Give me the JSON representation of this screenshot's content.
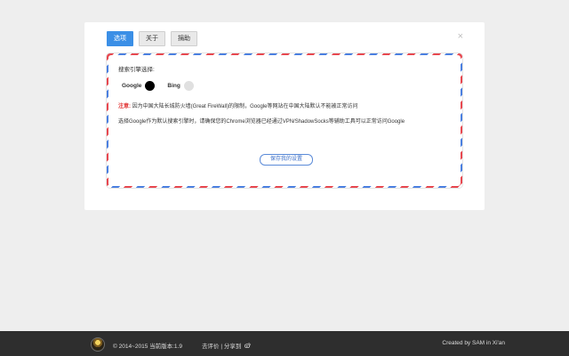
{
  "tabs": [
    {
      "label": "选项",
      "active": true
    },
    {
      "label": "关于",
      "active": false
    },
    {
      "label": "捐助",
      "active": false
    }
  ],
  "close_glyph": "×",
  "options": {
    "section_label": "搜索引擎选择:",
    "engines": [
      {
        "name": "Google",
        "selected": true
      },
      {
        "name": "Bing",
        "selected": false
      }
    ],
    "note_label": "注意:",
    "note_text": "因为中国大陆长城防火墙(Great FireWall)的限制，Google等网站在中国大陆默认不能被正常访问",
    "tip_text": "选择Google作为默认搜索引擎时，请确保您的Chrome浏览器已经通过VPN/ShadowSocks等辅助工具可以正常访问Google",
    "save_label": "保存我的设置"
  },
  "footer": {
    "copyright": "© 2014~2015 当前版本:1.9",
    "review_link": "去评价",
    "separator": "|",
    "share_link": "分享到",
    "share_icon": "weibo-icon",
    "credit": "Created by  SAM  in Xi'an"
  },
  "colors": {
    "accent": "#3b8fe6",
    "stripe_red": "#e7474f",
    "stripe_blue": "#4a7fe0",
    "note_red": "#e03030",
    "footer_bg": "#2e2e2e"
  }
}
